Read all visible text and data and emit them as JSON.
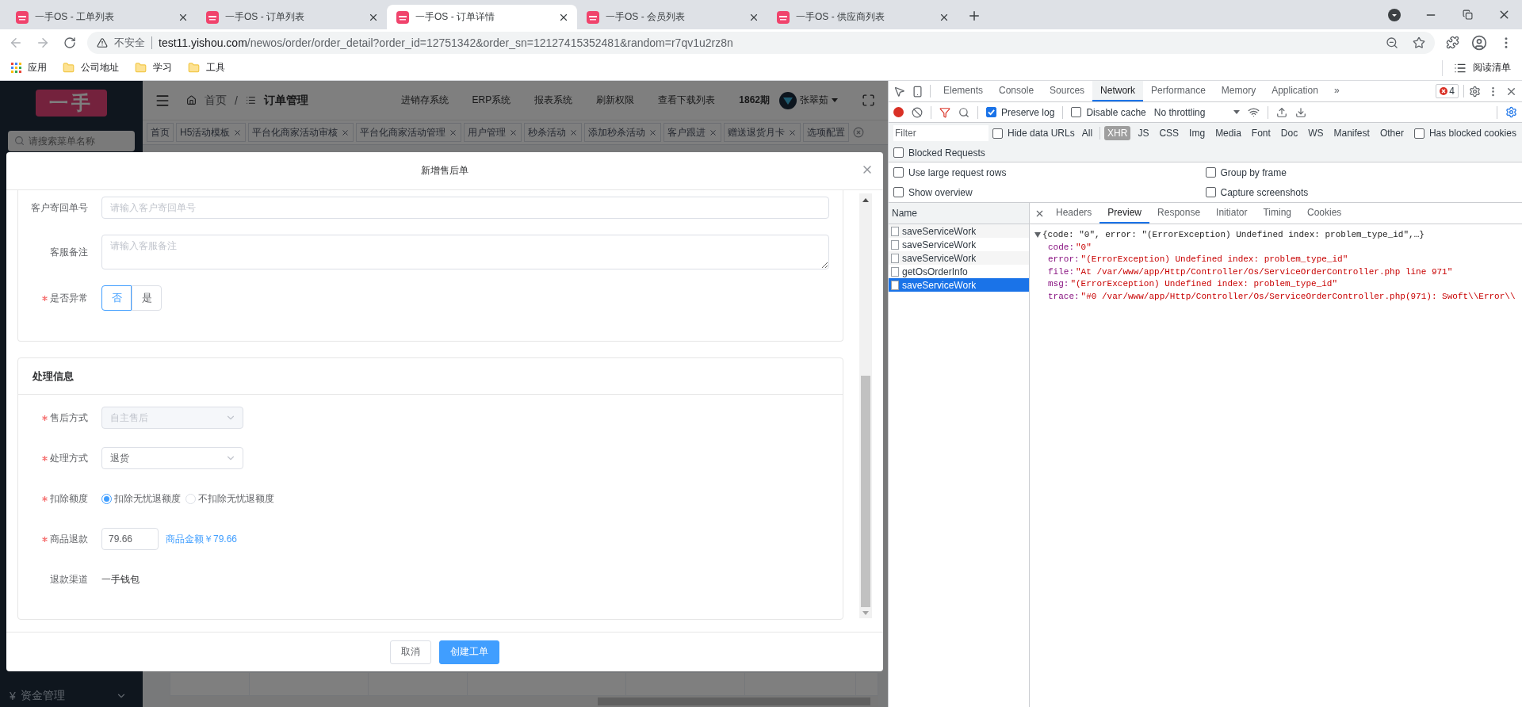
{
  "browser": {
    "tabs": [
      {
        "title": "一手OS - 工单列表",
        "selected": false
      },
      {
        "title": "一手OS - 订单列表",
        "selected": false
      },
      {
        "title": "一手OS - 订单详情",
        "selected": true
      },
      {
        "title": "一手OS - 会员列表",
        "selected": false
      },
      {
        "title": "一手OS - 供应商列表",
        "selected": false
      }
    ],
    "address_bar": {
      "security_label": "不安全",
      "host": "test11.yishou.com",
      "path": "/newos/order/order_detail?order_id=12751342&order_sn=12127415352481&random=r7qv1u2rz8n"
    },
    "bookmarks": [
      {
        "kind": "apps",
        "label": "应用"
      },
      {
        "kind": "folder",
        "label": "公司地址"
      },
      {
        "kind": "folder",
        "label": "学习"
      },
      {
        "kind": "folder",
        "label": "工具"
      }
    ],
    "reading_list": "阅读清单"
  },
  "app": {
    "logo": "一手",
    "menu_search": {
      "placeholder": "请搜索菜单名称"
    },
    "sidebar_items": [
      {
        "icon": "¥",
        "label": "资金管理"
      }
    ],
    "breadcrumb": {
      "items": [
        "首页",
        "订单管理"
      ],
      "separator": "/"
    },
    "nav_links": [
      "进销存系统",
      "ERP系统",
      "报表系统",
      "刷新权限",
      "查看下载列表"
    ],
    "period": "1862期",
    "user": "张翠茹",
    "page_tabs": [
      {
        "label": "首页",
        "closable": false
      },
      {
        "label": "H5活动模板",
        "closable": true
      },
      {
        "label": "平台化商家活动审核",
        "closable": true
      },
      {
        "label": "平台化商家活动管理",
        "closable": true
      },
      {
        "label": "用户管理",
        "closable": true
      },
      {
        "label": "秒杀活动",
        "closable": true
      },
      {
        "label": "添加秒杀活动",
        "closable": true
      },
      {
        "label": "客户跟进",
        "closable": true
      },
      {
        "label": "赠送退货月卡",
        "closable": true
      },
      {
        "label": "选项配置",
        "closable": false
      }
    ]
  },
  "modal": {
    "title": "新增售后单",
    "sections": [
      {
        "fields": [
          {
            "kind": "input",
            "label": "客户寄回单号",
            "required": false,
            "placeholder": "请输入客户寄回单号"
          },
          {
            "kind": "textarea",
            "label": "客服备注",
            "required": false,
            "placeholder": "请输入客服备注"
          },
          {
            "kind": "toggle",
            "label": "是否异常",
            "required": true,
            "options": [
              {
                "label": "否",
                "selected": true
              },
              {
                "label": "是",
                "selected": false
              }
            ]
          }
        ]
      },
      {
        "title": "处理信息",
        "fields": [
          {
            "kind": "select",
            "label": "售后方式",
            "required": true,
            "value": "自主售后",
            "disabled": true
          },
          {
            "kind": "select",
            "label": "处理方式",
            "required": true,
            "value": "退货",
            "disabled": false
          },
          {
            "kind": "radio",
            "label": "扣除额度",
            "required": true,
            "options": [
              {
                "label": "扣除无忧退额度",
                "selected": true
              },
              {
                "label": "不扣除无忧退额度",
                "selected": false
              }
            ]
          },
          {
            "kind": "amount",
            "label": "商品退款",
            "required": true,
            "value": "79.66",
            "hint": "商品金额￥79.66"
          },
          {
            "kind": "text",
            "label": "退款渠道",
            "required": false,
            "value": "一手钱包"
          }
        ]
      }
    ],
    "buttons": [
      {
        "label": "取消",
        "primary": false
      },
      {
        "label": "创建工单",
        "primary": true
      }
    ]
  },
  "devtools": {
    "panels": [
      {
        "label": "Elements",
        "selected": false
      },
      {
        "label": "Console",
        "selected": false
      },
      {
        "label": "Sources",
        "selected": false
      },
      {
        "label": "Network",
        "selected": true
      },
      {
        "label": "Performance",
        "selected": false
      },
      {
        "label": "Memory",
        "selected": false
      },
      {
        "label": "Application",
        "selected": false
      }
    ],
    "more_panels": "»",
    "error_count": "4",
    "toolbar_checks": [
      {
        "label": "Preserve log",
        "checked": true
      },
      {
        "label": "Disable cache",
        "checked": false
      }
    ],
    "throttling": "No throttling",
    "filter": {
      "placeholder": "Filter"
    },
    "hide_data_urls": {
      "label": "Hide data URLs",
      "checked": false
    },
    "types": [
      {
        "label": "All",
        "selected": false
      },
      {
        "label": "XHR",
        "selected": true
      },
      {
        "label": "JS",
        "selected": false
      },
      {
        "label": "CSS",
        "selected": false
      },
      {
        "label": "Img",
        "selected": false
      },
      {
        "label": "Media",
        "selected": false
      },
      {
        "label": "Font",
        "selected": false
      },
      {
        "label": "Doc",
        "selected": false
      },
      {
        "label": "WS",
        "selected": false
      },
      {
        "label": "Manifest",
        "selected": false
      },
      {
        "label": "Other",
        "selected": false
      }
    ],
    "has_blocked_cookies": {
      "label": "Has blocked cookies",
      "checked": false
    },
    "blocked_requests": {
      "label": "Blocked Requests",
      "checked": false
    },
    "options": [
      {
        "label": "Use large request rows",
        "checked": false
      },
      {
        "label": "Group by frame",
        "checked": false
      },
      {
        "label": "Show overview",
        "checked": false
      },
      {
        "label": "Capture screenshots",
        "checked": false
      }
    ],
    "name_header": "Name",
    "requests": [
      {
        "name": "saveServiceWork",
        "selected": false
      },
      {
        "name": "saveServiceWork",
        "selected": false
      },
      {
        "name": "saveServiceWork",
        "selected": false
      },
      {
        "name": "getOsOrderInfo",
        "selected": false
      },
      {
        "name": "saveServiceWork",
        "selected": true
      }
    ],
    "detail_tabs": [
      {
        "label": "Headers",
        "selected": false
      },
      {
        "label": "Preview",
        "selected": true
      },
      {
        "label": "Response",
        "selected": false
      },
      {
        "label": "Initiator",
        "selected": false
      },
      {
        "label": "Timing",
        "selected": false
      },
      {
        "label": "Cookies",
        "selected": false
      }
    ],
    "preview": {
      "summary": "{code: \"0\", error: \"(ErrorException) Undefined index: problem_type_id\",…}",
      "fields": [
        {
          "key": "code:",
          "value": "\"0\""
        },
        {
          "key": "error:",
          "value": "\"(ErrorException) Undefined index: problem_type_id\""
        },
        {
          "key": "file:",
          "value": "\"At /var/www/app/Http/Controller/Os/ServiceOrderController.php line 971\""
        },
        {
          "key": "msg:",
          "value": "\"(ErrorException) Undefined index: problem_type_id\""
        },
        {
          "key": "trace:",
          "value": "\"#0 /var/www/app/Http/Controller/Os/ServiceOrderController.php(971): Swoft\\\\Error\\\\"
        }
      ]
    }
  }
}
